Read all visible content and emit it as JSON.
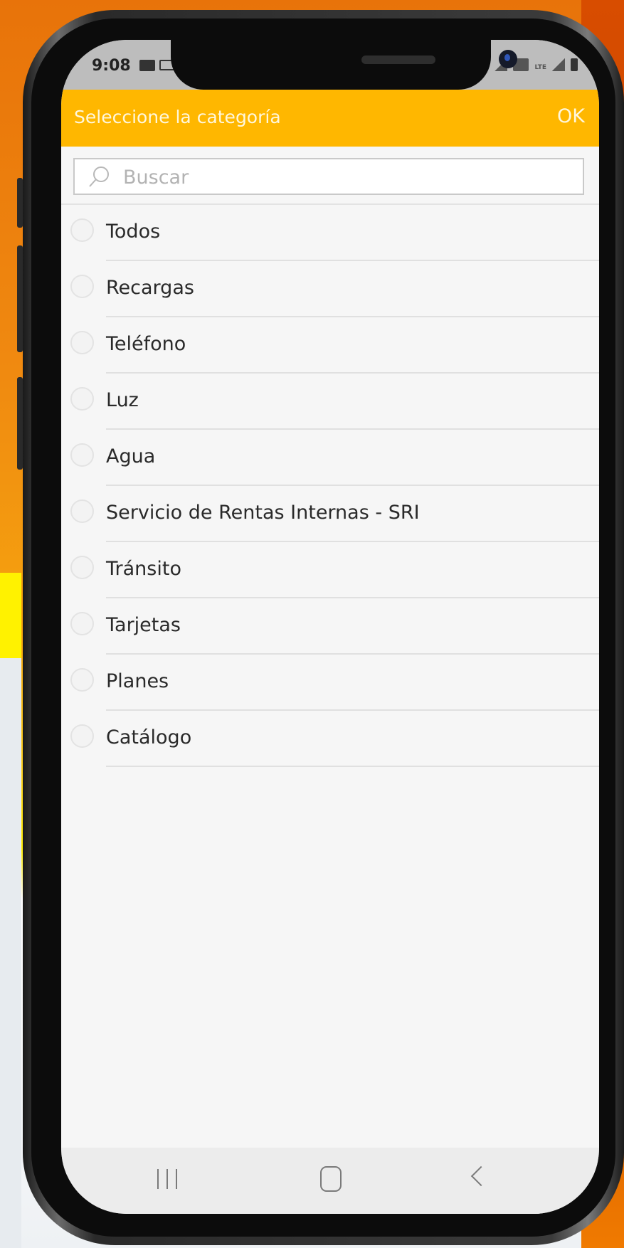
{
  "status_bar": {
    "time": "9:08"
  },
  "header": {
    "title": "Seleccione la categoría",
    "ok_label": "OK"
  },
  "search": {
    "placeholder": "Buscar",
    "value": ""
  },
  "categories": [
    {
      "label": "Todos",
      "selected": false
    },
    {
      "label": "Recargas",
      "selected": false
    },
    {
      "label": "Teléfono",
      "selected": false
    },
    {
      "label": "Luz",
      "selected": false
    },
    {
      "label": "Agua",
      "selected": false
    },
    {
      "label": "Servicio de Rentas Internas - SRI",
      "selected": false
    },
    {
      "label": "Tránsito",
      "selected": false
    },
    {
      "label": "Tarjetas",
      "selected": false
    },
    {
      "label": "Planes",
      "selected": false
    },
    {
      "label": "Catálogo",
      "selected": false
    }
  ],
  "icons": {
    "search": "search-icon",
    "nav_recent": "recent-apps-icon",
    "nav_home": "home-icon",
    "nav_back": "back-icon"
  },
  "colors": {
    "header": "#ffb700",
    "header_text": "#fff7dc",
    "background": "#f6f6f6"
  }
}
